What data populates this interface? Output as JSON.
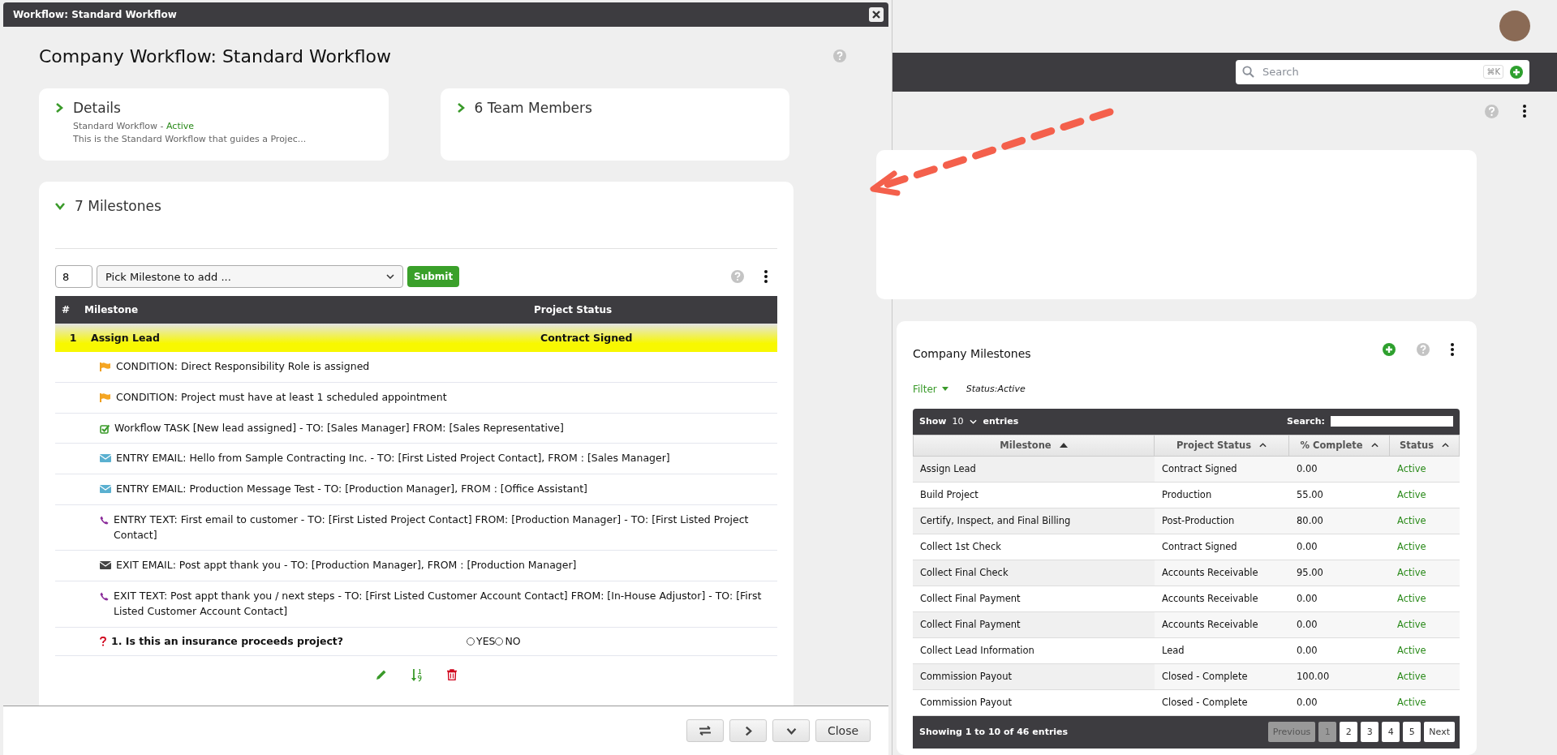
{
  "modal": {
    "title": "Workflow: Standard Workflow",
    "heading": "Company Workflow: Standard Workflow",
    "details": {
      "title": "Details",
      "subtitle": "Standard Workflow - ",
      "status": "Active",
      "description": "This is the Standard Workflow that guides a Projec..."
    },
    "team": {
      "title": "6 Team Members"
    },
    "milestones": {
      "title": "7 Milestones",
      "number_input": "8",
      "select_placeholder": "Pick Milestone to add ...",
      "submit": "Submit",
      "columns": [
        "#",
        "Milestone",
        "Project Status"
      ],
      "rows": [
        {
          "number": "1",
          "name": "Assign Lead",
          "status": "Contract Signed",
          "highlighted": true
        }
      ],
      "items": [
        {
          "kind": "condition",
          "text": "CONDITION: Direct Responsibility Role is assigned"
        },
        {
          "kind": "condition",
          "text": "CONDITION: Project must have at least 1 scheduled appointment"
        },
        {
          "kind": "task",
          "text": "Workflow TASK [New lead assigned] - TO: [Sales Manager] FROM: [Sales Representative]"
        },
        {
          "kind": "entry_email",
          "text": "ENTRY EMAIL: Hello from Sample Contracting Inc. - TO: [First Listed Project Contact], FROM : [Sales Manager]"
        },
        {
          "kind": "entry_email",
          "text": "ENTRY EMAIL: Production Message Test - TO: [Production Manager], FROM : [Office Assistant]"
        },
        {
          "kind": "text",
          "text": "ENTRY TEXT: First email to customer - TO: [First Listed Project Contact] FROM: [Production Manager] - TO: [First Listed Project Contact]"
        },
        {
          "kind": "exit_email",
          "text": "EXIT EMAIL: Post appt thank you - TO: [Production Manager], FROM : [Production Manager]"
        },
        {
          "kind": "text",
          "text": "EXIT TEXT: Post appt thank you / next steps - TO: [First Listed Customer Account Contact] FROM: [In-House Adjustor] - TO: [First Listed Customer Account Contact]"
        }
      ],
      "question": {
        "text": "1. Is this an insurance proceeds project?",
        "options": [
          {
            "label": "YES",
            "checked": false
          },
          {
            "label": "NO",
            "checked": false
          }
        ]
      }
    },
    "close": "Close"
  },
  "page": {
    "search": {
      "placeholder": "Search",
      "shortcut": "⌘K"
    },
    "company_milestones": {
      "title": "Company Milestones",
      "filter": "Filter",
      "filter_value": "Status:Active",
      "show": "Show",
      "page_length": "10",
      "entries": "entries",
      "search_label": "Search:",
      "columns": [
        {
          "label": "Milestone",
          "sorted": true
        },
        {
          "label": "Project Status",
          "sorted": false
        },
        {
          "label": "% Complete",
          "sorted": false
        },
        {
          "label": "Status",
          "sorted": false
        }
      ],
      "rows": [
        [
          "Assign Lead",
          "Contract Signed",
          "0.00",
          "Active"
        ],
        [
          "Build Project",
          "Production",
          "55.00",
          "Active"
        ],
        [
          "Certify, Inspect, and Final Billing",
          "Post-Production",
          "80.00",
          "Active"
        ],
        [
          "Collect 1st Check",
          "Contract Signed",
          "0.00",
          "Active"
        ],
        [
          "Collect Final Check",
          "Accounts Receivable",
          "95.00",
          "Active"
        ],
        [
          "Collect Final Payment",
          "Accounts Receivable",
          "0.00",
          "Active"
        ],
        [
          "Collect Final Payment",
          "Accounts Receivable",
          "0.00",
          "Active"
        ],
        [
          "Collect Lead Information",
          "Lead",
          "0.00",
          "Active"
        ],
        [
          "Commission Payout",
          "Closed - Complete",
          "100.00",
          "Active"
        ],
        [
          "Commission Payout",
          "Closed - Complete",
          "0.00",
          "Active"
        ]
      ],
      "info": "Showing 1 to 10 of 46 entries",
      "previous": {
        "label": "Previous",
        "disabled": true
      },
      "pages": [
        {
          "label": "1",
          "selected": true
        },
        {
          "label": "2",
          "selected": false
        },
        {
          "label": "3",
          "selected": false
        },
        {
          "label": "4",
          "selected": false
        },
        {
          "label": "5",
          "selected": false
        }
      ],
      "next": {
        "label": "Next",
        "disabled": false
      }
    }
  }
}
